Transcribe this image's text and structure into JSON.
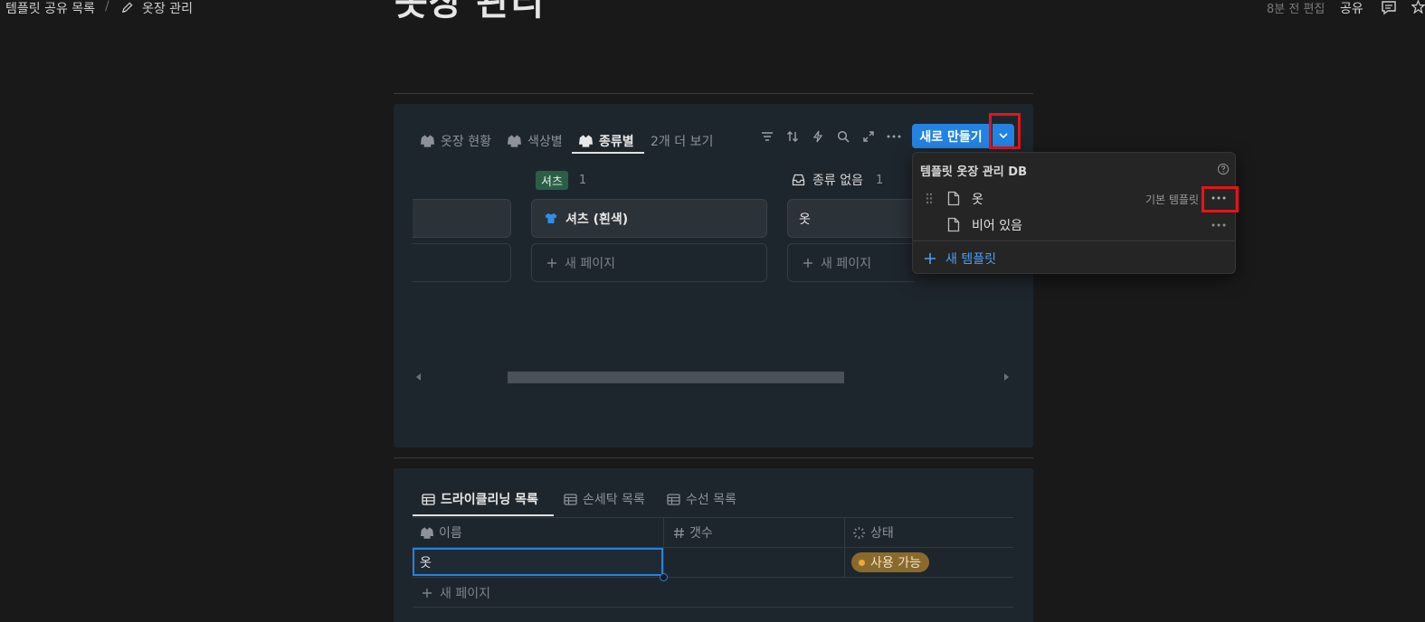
{
  "topbar": {
    "breadcrumb_root": "템플릿 공유 목록",
    "breadcrumb_sep": "/",
    "breadcrumb_page": "옷장 관리",
    "edited": "8분 전 편집",
    "share": "공유"
  },
  "page": {
    "title": "옷장 관리"
  },
  "board": {
    "tabs": [
      {
        "label": "옷장 현황"
      },
      {
        "label": "색상별"
      },
      {
        "label": "종류별"
      },
      {
        "label": "2개 더 보기"
      }
    ],
    "new_button": "새로 만들기",
    "groups": [
      {
        "tag": "셔츠",
        "count": "1",
        "card_title": "셔츠 (흰색)",
        "new_page": "새 페이지"
      },
      {
        "tag": "종류 없음",
        "count": "1",
        "card_title": "옷",
        "new_page": "새 페이지"
      }
    ]
  },
  "template_menu": {
    "title": "템플릿 옷장 관리 DB",
    "items": [
      {
        "label": "옷",
        "badge": "기본 템플릿"
      },
      {
        "label": "비어 있음"
      }
    ],
    "new_template": "새 템플릿"
  },
  "table": {
    "tabs": [
      {
        "label": "드라이클리닝 목록"
      },
      {
        "label": "손세탁 목록"
      },
      {
        "label": "수선 목록"
      }
    ],
    "columns": [
      {
        "label": "이름"
      },
      {
        "label": "갯수"
      },
      {
        "label": "상태"
      }
    ],
    "rows": [
      {
        "name": "옷",
        "count": "",
        "status": "사용 가능"
      }
    ],
    "new_page": "새 페이지"
  },
  "colors": {
    "accent": "#2383e2",
    "highlight": "#e4141b",
    "status_pill": "#8a6a2c",
    "tag_green": "#2b5e46"
  }
}
